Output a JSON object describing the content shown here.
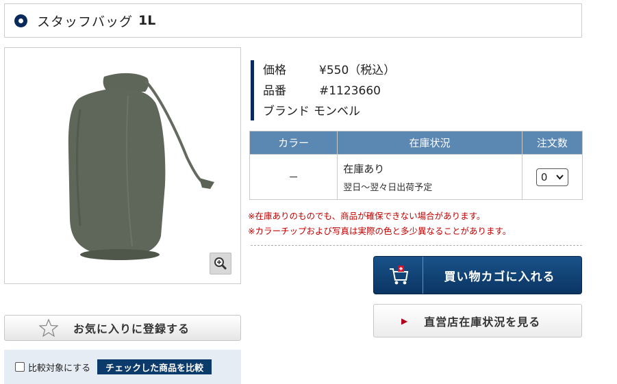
{
  "product": {
    "name": "スタッフバッグ",
    "size": "1L"
  },
  "info": {
    "price_label": "価格",
    "price_value": "¥550（税込）",
    "sku_label": "品番",
    "sku_value": "#1123660",
    "brand_label": "ブランド",
    "brand_value": "モンベル"
  },
  "stock_table": {
    "headers": [
      "カラー",
      "在庫状況",
      "注文数"
    ],
    "rows": [
      {
        "color": "－",
        "status": "在庫あり",
        "delivery": "翌日～翌々日出荷予定",
        "qty": "0"
      }
    ]
  },
  "notes": [
    "※在庫ありのものでも、商品が確保できない場合があります。",
    "※カラーチップおよび写真は実際の色と多少異なることがあります。"
  ],
  "buttons": {
    "cart": "買い物カゴに入れる",
    "store_stock": "直営店在庫状況を見る",
    "favorite": "お気に入りに登録する",
    "compare_checkbox": "比較対象にする",
    "compare": "チェックした商品を比較"
  },
  "icons": {
    "title_bullet": "circle-bullet-icon",
    "zoom": "zoom-in-icon",
    "cart": "cart-add-icon",
    "store": "arrow-right-icon",
    "favorite": "star-outline-icon"
  },
  "colors": {
    "navy": "#0b2a5c",
    "table_header": "#5b87b3",
    "notice_red": "#c00000",
    "bag": "#5f665a"
  }
}
